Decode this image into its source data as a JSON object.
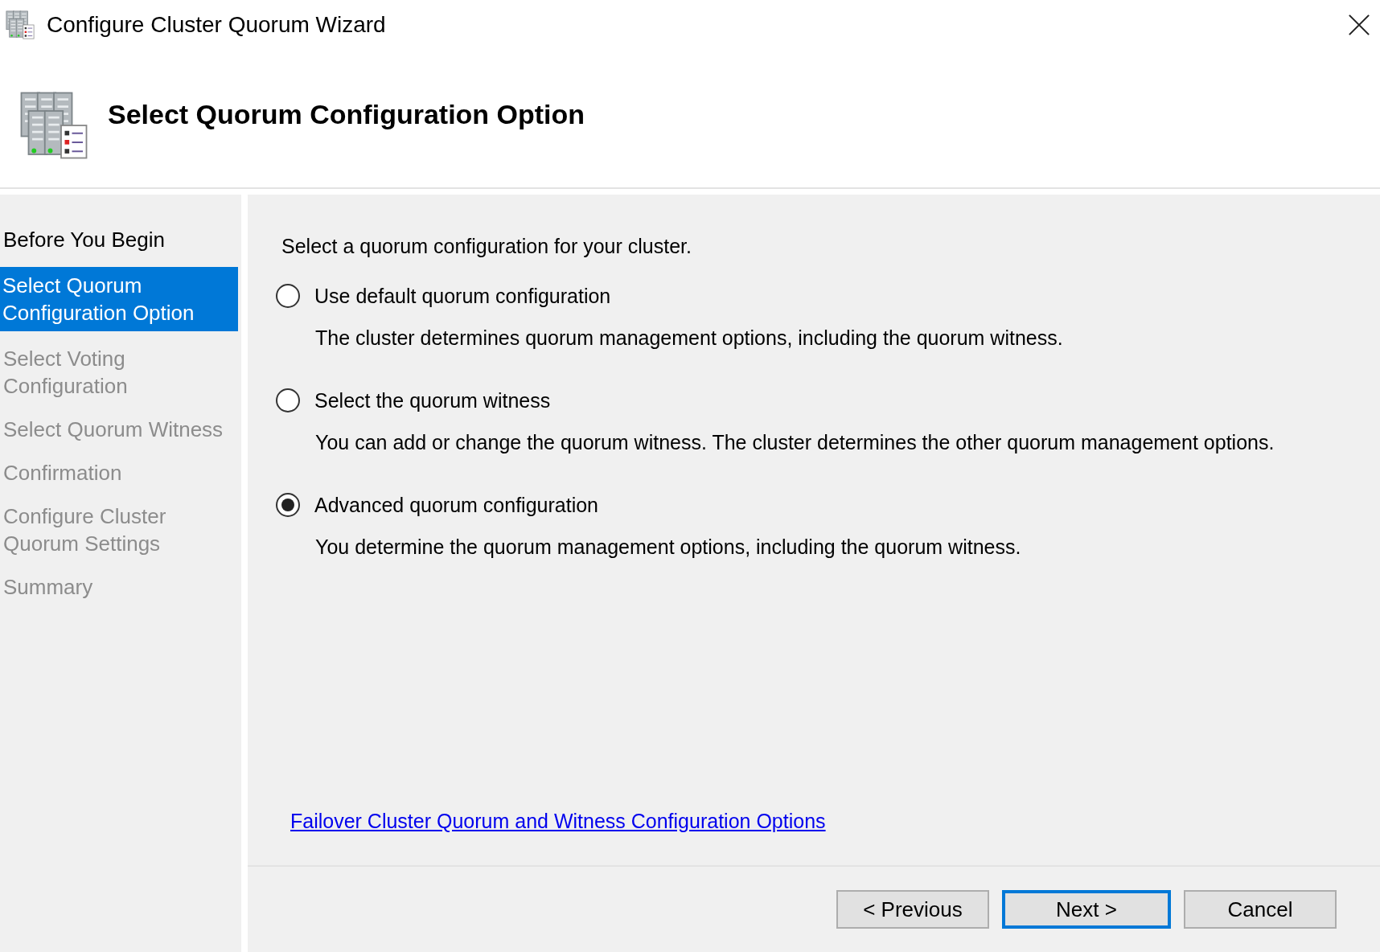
{
  "window": {
    "title": "Configure Cluster Quorum Wizard"
  },
  "header": {
    "title": "Select Quorum Configuration Option"
  },
  "steps": [
    {
      "label": "Before You Begin",
      "selected": false,
      "dimmed": false
    },
    {
      "label": "Select Quorum Configuration Option",
      "selected": true,
      "dimmed": false
    },
    {
      "label": "Select Voting Configuration",
      "selected": false,
      "dimmed": true
    },
    {
      "label": "Select Quorum Witness",
      "selected": false,
      "dimmed": true
    },
    {
      "label": "Confirmation",
      "selected": false,
      "dimmed": true
    },
    {
      "label": "Configure Cluster Quorum Settings",
      "selected": false,
      "dimmed": true
    },
    {
      "label": "Summary",
      "selected": false,
      "dimmed": true
    }
  ],
  "intro": "Select a quorum configuration for your cluster.",
  "options": [
    {
      "label": "Use default quorum configuration",
      "description": "The cluster determines quorum management options, including the quorum witness.",
      "selected": false
    },
    {
      "label": "Select the quorum witness",
      "description": "You can add or change the quorum witness. The cluster determines the other quorum management options.",
      "selected": false
    },
    {
      "label": "Advanced quorum configuration",
      "description": "You determine the quorum management options, including the quorum witness.",
      "selected": true
    }
  ],
  "help_link": "Failover Cluster Quorum and Witness Configuration Options",
  "buttons": [
    {
      "label": "< Previous",
      "default": false
    },
    {
      "label": "Next >",
      "default": true
    },
    {
      "label": "Cancel",
      "default": false
    }
  ]
}
